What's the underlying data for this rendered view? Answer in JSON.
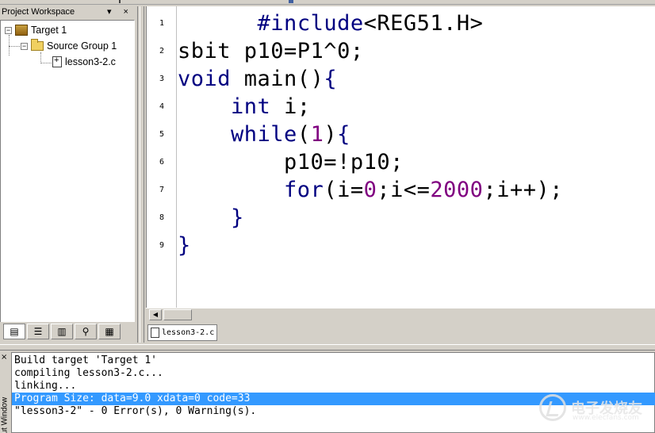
{
  "workspace": {
    "title": "Project Workspace",
    "title_buttons": "▾ ×",
    "tree": {
      "target": "Target 1",
      "group": "Source Group 1",
      "file": "lesson3-2.c"
    }
  },
  "editor": {
    "line_numbers": [
      "1",
      "2",
      "3",
      "4",
      "5",
      "6",
      "7",
      "8",
      "9"
    ],
    "file_tab": "lesson3-2.c"
  },
  "output": {
    "side_label": "ut Window",
    "lines": [
      "Build target 'Target 1'",
      "compiling lesson3-2.c...",
      "linking...",
      "Program Size: data=9.0 xdata=0 code=33",
      "\"lesson3-2\" - 0 Error(s), 0 Warning(s)."
    ]
  },
  "watermark": {
    "title": "电子发烧友",
    "url": "www.elecfans.com"
  },
  "colors": {
    "keyword": "#000080",
    "number": "#800080",
    "selection": "#3399ff"
  }
}
